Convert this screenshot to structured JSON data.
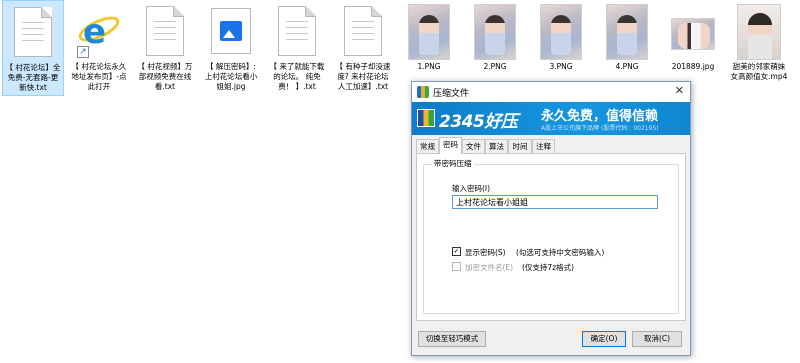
{
  "explorer": {
    "files": [
      {
        "kind": "txt",
        "name": "【 村花论坛】全免费-无套路-更新快.txt",
        "selected": true
      },
      {
        "kind": "ie",
        "name": "【 村花论坛永久地址发布页】-点此打开"
      },
      {
        "kind": "txt",
        "name": "【 村花视频】万部视频免费在线看.txt"
      },
      {
        "kind": "jpg",
        "name": "【 解压密码】: 上村花论坛看小姐姐.jpg"
      },
      {
        "kind": "txt",
        "name": "【 来了就能下载的论坛。 纯免费！ 】.txt"
      },
      {
        "kind": "txt",
        "name": "【 有种子却没速度? 来村花论坛人工加速】.txt"
      },
      {
        "kind": "photo",
        "name": "1.PNG"
      },
      {
        "kind": "photo",
        "name": "2.PNG"
      },
      {
        "kind": "photo",
        "name": "3.PNG"
      },
      {
        "kind": "photo",
        "name": "4.PNG"
      },
      {
        "kind": "photo-wide",
        "name": "201889.jpg"
      },
      {
        "kind": "mp4",
        "name": "甜美的邻家萌妹女高颜值女.mp4"
      }
    ]
  },
  "dialog": {
    "title": "压缩文件",
    "close_glyph": "✕",
    "banner": {
      "brand": "2345好压",
      "slogan": "永久免费，值得信赖",
      "subline": "A股上市公司旗下品牌 (股票代码：002195)"
    },
    "tabs": [
      "常规",
      "密码",
      "文件",
      "算法",
      "时间",
      "注释"
    ],
    "active_tab_index": 1,
    "group_title": "带密码压缩",
    "password_label": "输入密码(I)",
    "password_value": "上村花论坛看小姐姐",
    "show_password": {
      "label": "显示密码(S)",
      "checked": true,
      "hint": "(勾选可支持中文密码输入)"
    },
    "encrypt_names": {
      "label": "加密文件名(E)",
      "checked": false,
      "enabled": false,
      "hint": "(仅支持7z格式)"
    },
    "buttons": {
      "simple_mode": "切换至轻巧模式",
      "ok": "确定(O)",
      "cancel": "取消(C)"
    }
  }
}
